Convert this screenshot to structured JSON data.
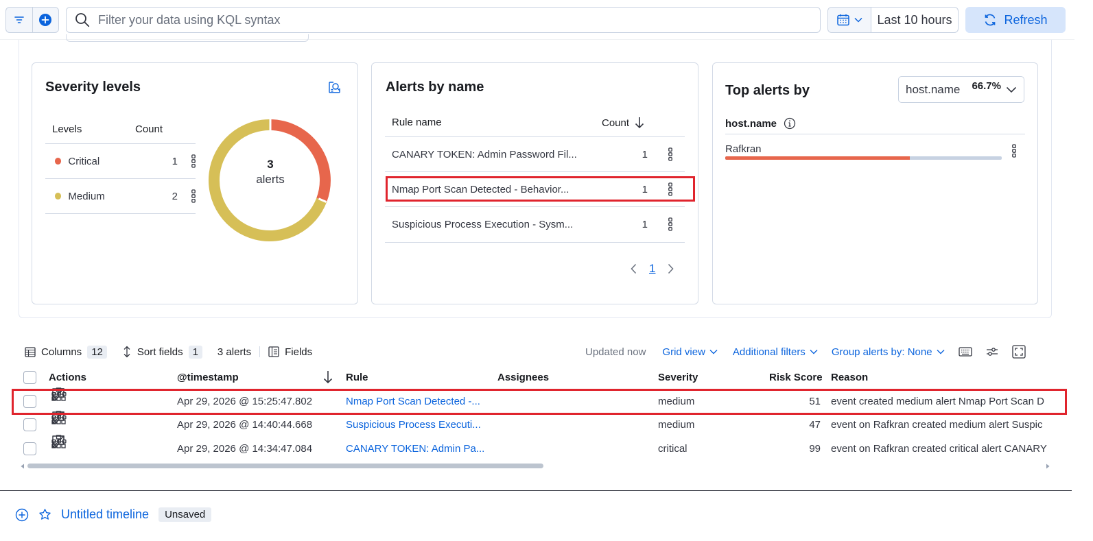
{
  "search": {
    "placeholder": "Filter your data using KQL syntax"
  },
  "date_picker": {
    "range_label": "Last 10 hours"
  },
  "refresh": {
    "label": "Refresh"
  },
  "severity_card": {
    "title": "Severity levels",
    "col_levels": "Levels",
    "col_count": "Count",
    "rows": [
      {
        "level": "Critical",
        "count": "1",
        "color": "#e7664c"
      },
      {
        "level": "Medium",
        "count": "2",
        "color": "#d6bf57"
      }
    ],
    "donut": {
      "total": "3",
      "unit": "alerts"
    }
  },
  "alerts_by_name": {
    "title": "Alerts by name",
    "col_rule": "Rule name",
    "col_count": "Count",
    "rows": [
      {
        "name": "CANARY TOKEN: Admin Password Fil...",
        "count": "1"
      },
      {
        "name": "Nmap Port Scan Detected - Behavior...",
        "count": "1"
      },
      {
        "name": "Suspicious Process Execution - Sysm...",
        "count": "1"
      }
    ],
    "page": "1"
  },
  "top_alerts": {
    "title": "Top alerts by",
    "select_value": "host.name",
    "field_label": "host.name",
    "rows": [
      {
        "host": "Rafkran",
        "percent_label": "66.7%",
        "fraction": 0.667
      }
    ]
  },
  "toolbar": {
    "columns_label": "Columns",
    "columns_count": "12",
    "sort_label": "Sort fields",
    "sort_count": "1",
    "alerts_count": "3 alerts",
    "fields_label": "Fields",
    "updated": "Updated now",
    "grid_view": "Grid view",
    "additional_filters": "Additional filters",
    "group_by": "Group alerts by: None"
  },
  "grid": {
    "headers": {
      "actions": "Actions",
      "timestamp": "@timestamp",
      "rule": "Rule",
      "assignees": "Assignees",
      "severity": "Severity",
      "risk": "Risk Score",
      "reason": "Reason"
    },
    "rows": [
      {
        "timestamp": "Apr 29, 2026 @ 15:25:47.802",
        "rule": "Nmap Port Scan Detected -...",
        "severity": "medium",
        "risk": "51",
        "reason": "event created medium alert Nmap Port Scan D"
      },
      {
        "timestamp": "Apr 29, 2026 @ 14:40:44.668",
        "rule": "Suspicious Process Executi...",
        "severity": "medium",
        "risk": "47",
        "reason": "event on Rafkran created medium alert Suspic"
      },
      {
        "timestamp": "Apr 29, 2026 @ 14:34:47.084",
        "rule": "CANARY TOKEN: Admin Pa...",
        "severity": "critical",
        "risk": "99",
        "reason": "event on Rafkran created critical alert CANARY"
      }
    ]
  },
  "timeline": {
    "title": "Untitled timeline",
    "status": "Unsaved"
  }
}
